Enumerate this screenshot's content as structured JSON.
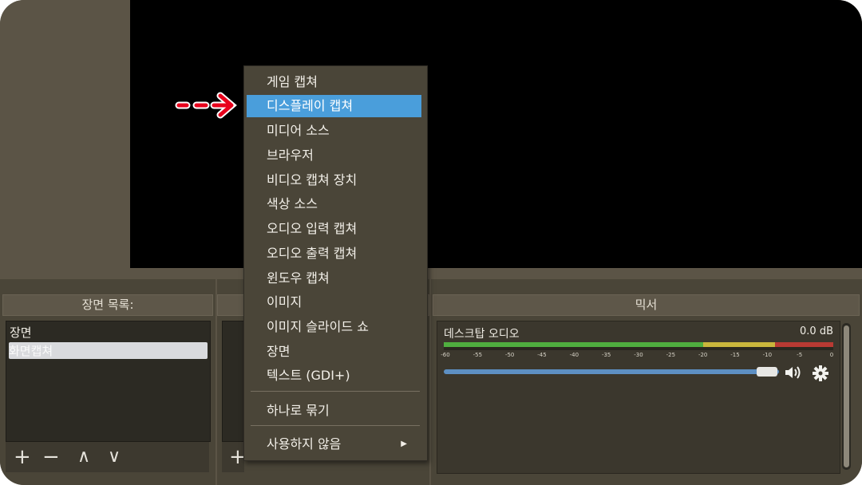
{
  "panels": {
    "scenes_header": "장면 목록:",
    "mixer_header": "믹서"
  },
  "scenes": {
    "items": [
      "장면",
      "화면캡쳐"
    ],
    "selected_index": 1,
    "toolbar": {
      "add": "+",
      "remove": "−",
      "up": "∧",
      "down": "∨"
    }
  },
  "sources": {
    "toolbar": {
      "add": "+"
    }
  },
  "mixer": {
    "channel_name": "데스크탑 오디오",
    "level": "0.0 dB",
    "ticks": [
      "-60",
      "-55",
      "-50",
      "-45",
      "-40",
      "-35",
      "-30",
      "-25",
      "-20",
      "-15",
      "-10",
      "-5",
      "0"
    ],
    "volume_fraction": 0.96,
    "icons": {
      "speaker": "speaker-icon",
      "settings": "gear-icon"
    }
  },
  "context_menu": {
    "items": [
      "게임 캡쳐",
      "디스플레이 캡쳐",
      "미디어 소스",
      "브라우저",
      "비디오 캡쳐 장치",
      "색상 소스",
      "오디오 입력 캡쳐",
      "오디오 출력 캡쳐",
      "윈도우 캡쳐",
      "이미지",
      "이미지 슬라이드 쇼",
      "장면",
      "텍스트 (GDI+)"
    ],
    "highlighted_index": 1,
    "group_item": "하나로 묶기",
    "deprecated_item": "사용하지 않음",
    "submenu_arrow": "▶"
  },
  "colors": {
    "highlight": "#4a9edb",
    "annotation": "#e8001c",
    "meter_green": "#4fae3f",
    "meter_yellow": "#c9b63c",
    "meter_red": "#b83a33"
  }
}
